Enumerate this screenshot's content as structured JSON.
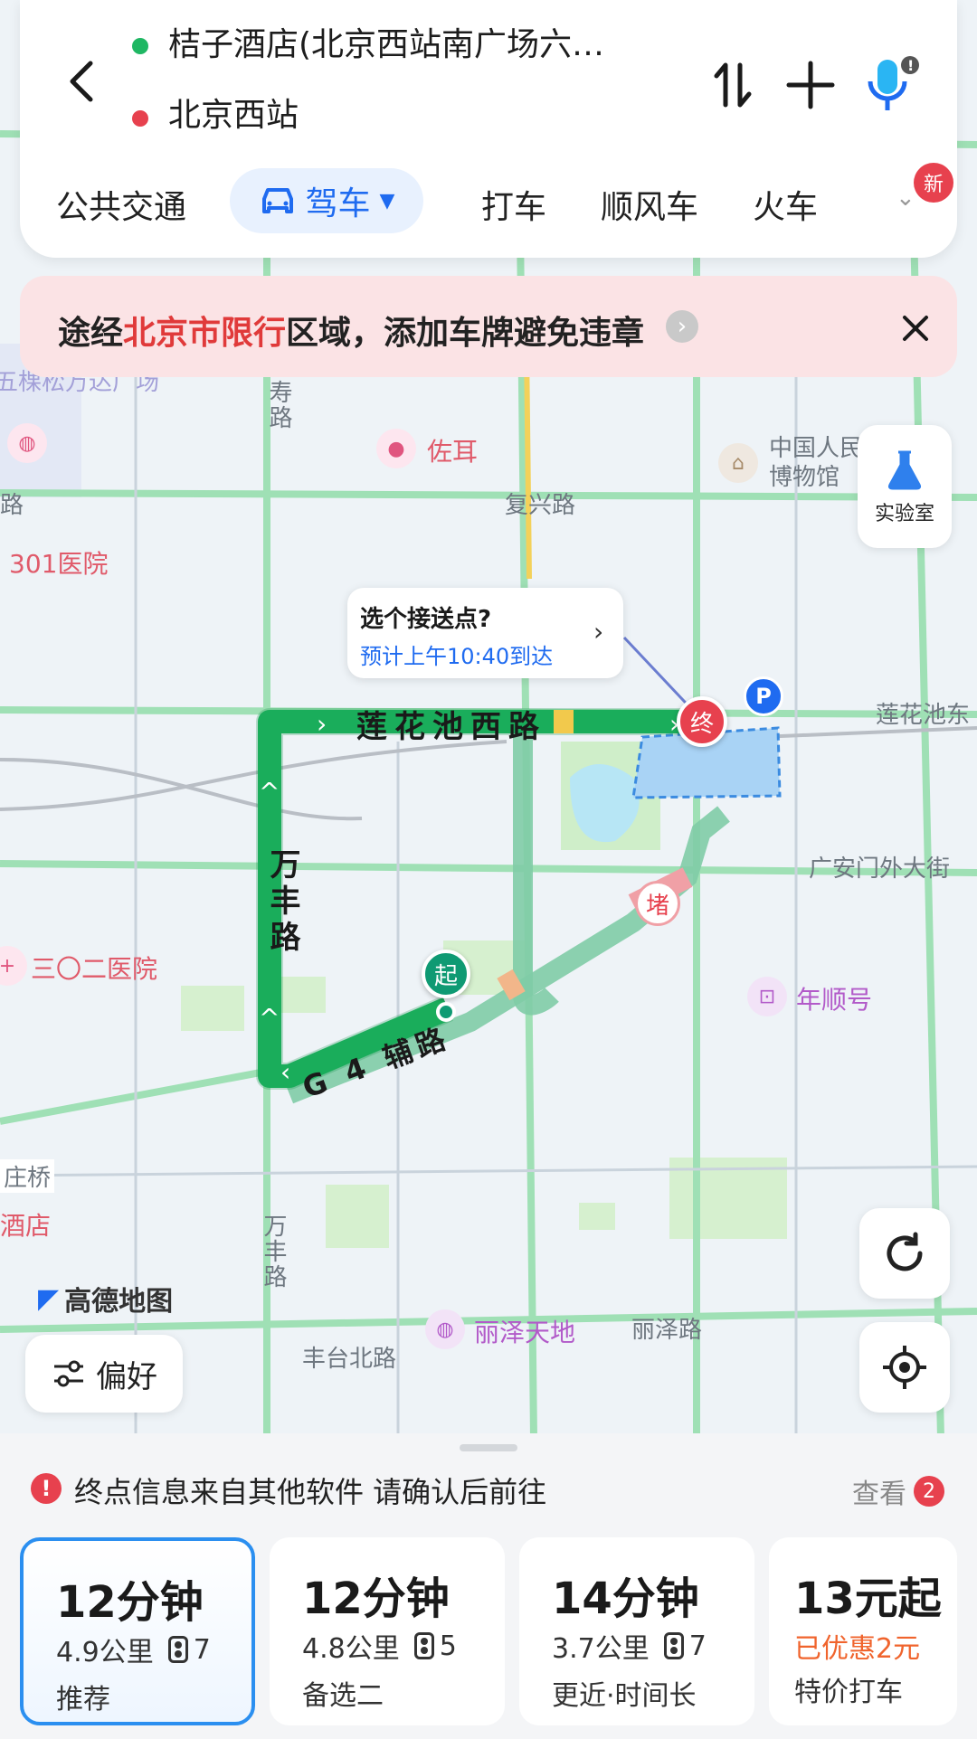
{
  "header": {
    "origin": "桔子酒店(北京西站南广场六…",
    "destination": "北京西站",
    "swap_icon": "swap-vertical-icon",
    "add_icon": "plus-icon",
    "voice_icon": "microphone-icon"
  },
  "modes": {
    "items": [
      "公共交通",
      "驾车",
      "打车",
      "顺风车",
      "火车"
    ],
    "new_badge": "新"
  },
  "banner": {
    "prefix": "途经",
    "highlight": "北京市限行",
    "suffix": "区域，添加车牌避免违章"
  },
  "map": {
    "labels": {
      "road_wanshou": "寿路",
      "zuoer": "佐耳",
      "museum": "中国人民\n博物馆",
      "fuxing": "复兴路",
      "hospital301": "301医院",
      "lianhuachi_xi": "莲花池西路",
      "lianhuachi_dong": "莲花池东",
      "guanganmen": "广安门外大街",
      "wanfeng": "万丰路",
      "wanfeng_lower": "万丰路",
      "hospital302": "三〇二医院",
      "nianshunhao": "年顺号",
      "g4": "G 4 辅路",
      "zhuangqiao": "庄桥",
      "hotel": "酒店",
      "lize": "丽泽天地",
      "lize_road": "丽泽路",
      "fengtai_north": "丰台北路",
      "left_top": "五棵松万达广场",
      "luo": "路",
      "congestion": "堵",
      "start": "起",
      "end": "终",
      "parking": "P",
      "brand": "高德地图"
    },
    "callout": {
      "title": "选个接送点?",
      "eta": "预计上午10:40到达"
    },
    "lab_button": "实验室",
    "preference_button": "偏好"
  },
  "sheet": {
    "notice": "终点信息来自其他软件 请确认后前往",
    "view_label": "查看",
    "view_count": "2",
    "routes": [
      {
        "time": "12分钟",
        "distance": "4.9公里",
        "lights": "7",
        "tag": "推荐"
      },
      {
        "time": "12分钟",
        "distance": "4.8公里",
        "lights": "5",
        "tag": "备选二"
      },
      {
        "time": "14分钟",
        "distance": "3.7公里",
        "lights": "7",
        "tag": "更近·时间长"
      }
    ],
    "taxi": {
      "price": "13元起",
      "discount": "已优惠2元",
      "tag": "特价打车"
    }
  },
  "colors": {
    "accent": "#1f6bf0",
    "route_green": "#16b35a",
    "alert_red": "#e03a3a",
    "banner_bg": "#fbe3e5"
  }
}
